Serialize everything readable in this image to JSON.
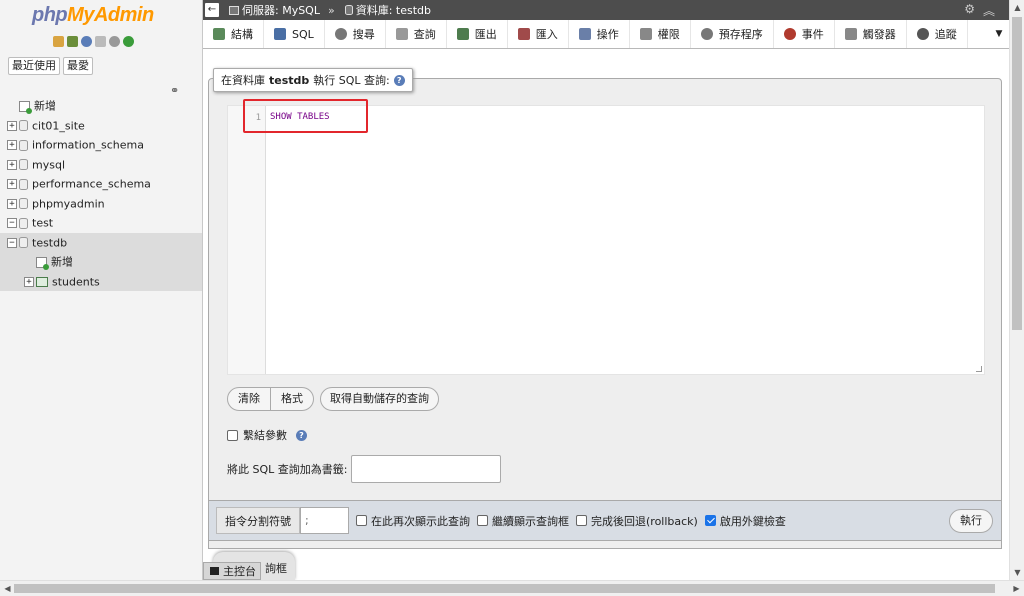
{
  "logo": {
    "php": "php",
    "rest": "MyAdmin"
  },
  "nav": {
    "buttons": [
      "最近使用",
      "最愛"
    ],
    "link_icon": "link-icon",
    "tree": [
      {
        "label": "新增",
        "type": "new",
        "expander": ""
      },
      {
        "label": "cit01_site",
        "type": "db",
        "expander": "+"
      },
      {
        "label": "information_schema",
        "type": "db",
        "expander": "+"
      },
      {
        "label": "mysql",
        "type": "db",
        "expander": "+"
      },
      {
        "label": "performance_schema",
        "type": "db",
        "expander": "+"
      },
      {
        "label": "phpmyadmin",
        "type": "db",
        "expander": "+"
      },
      {
        "label": "test",
        "type": "db",
        "expander": "−"
      },
      {
        "label": "testdb",
        "type": "db",
        "expander": "−",
        "selected": true
      },
      {
        "label": "新增",
        "type": "new",
        "expander": "",
        "child": true
      },
      {
        "label": "students",
        "type": "table",
        "expander": "+",
        "child": true
      }
    ]
  },
  "topbar": {
    "back": "←",
    "server": "伺服器: MySQL",
    "separator": "»",
    "database": "資料庫: testdb",
    "settings_icon": "gear-icon",
    "collapse_icon": "collapse-icon"
  },
  "menu": {
    "tabs": [
      {
        "label": "結構",
        "color": "#5a8a5a"
      },
      {
        "label": "SQL",
        "color": "#4a6fa5"
      },
      {
        "label": "搜尋",
        "color": "#777777"
      },
      {
        "label": "查詢",
        "color": "#999999"
      },
      {
        "label": "匯出",
        "color": "#4e7c4e"
      },
      {
        "label": "匯入",
        "color": "#a04a4a"
      },
      {
        "label": "操作",
        "color": "#6a7fa8"
      },
      {
        "label": "權限",
        "color": "#888888"
      },
      {
        "label": "預存程序",
        "color": "#777777"
      },
      {
        "label": "事件",
        "color": "#b03a2e"
      },
      {
        "label": "觸發器",
        "color": "#888888"
      },
      {
        "label": "追蹤",
        "color": "#555555"
      }
    ],
    "more": "▼"
  },
  "query": {
    "legend_prefix": "在資料庫",
    "legend_db": "testdb",
    "legend_suffix": "執行 SQL 查詢:",
    "help": "?",
    "line_number": "1",
    "code": "SHOW TABLES",
    "highlight_color": "#e2262c"
  },
  "buttons": {
    "clear": "清除",
    "format": "格式",
    "auto_saved": "取得自動儲存的查詢"
  },
  "bind_params": {
    "label": "繫結參數",
    "checked": false
  },
  "bookmark": {
    "label": "將此 SQL 查詢加為書籤:",
    "value": ""
  },
  "options": {
    "delimiter_label": "指令分割符號",
    "delimiter_value": ";",
    "items": [
      {
        "label": "在此再次顯示此查詢",
        "checked": false
      },
      {
        "label": "繼續顯示查詢框",
        "checked": false
      },
      {
        "label": "完成後回退(rollback)",
        "checked": false
      },
      {
        "label": "啟用外鍵檢查",
        "checked": true
      }
    ],
    "execute": "執行"
  },
  "footer": {
    "prev_tab_label": "詢框",
    "console": "主控台"
  }
}
